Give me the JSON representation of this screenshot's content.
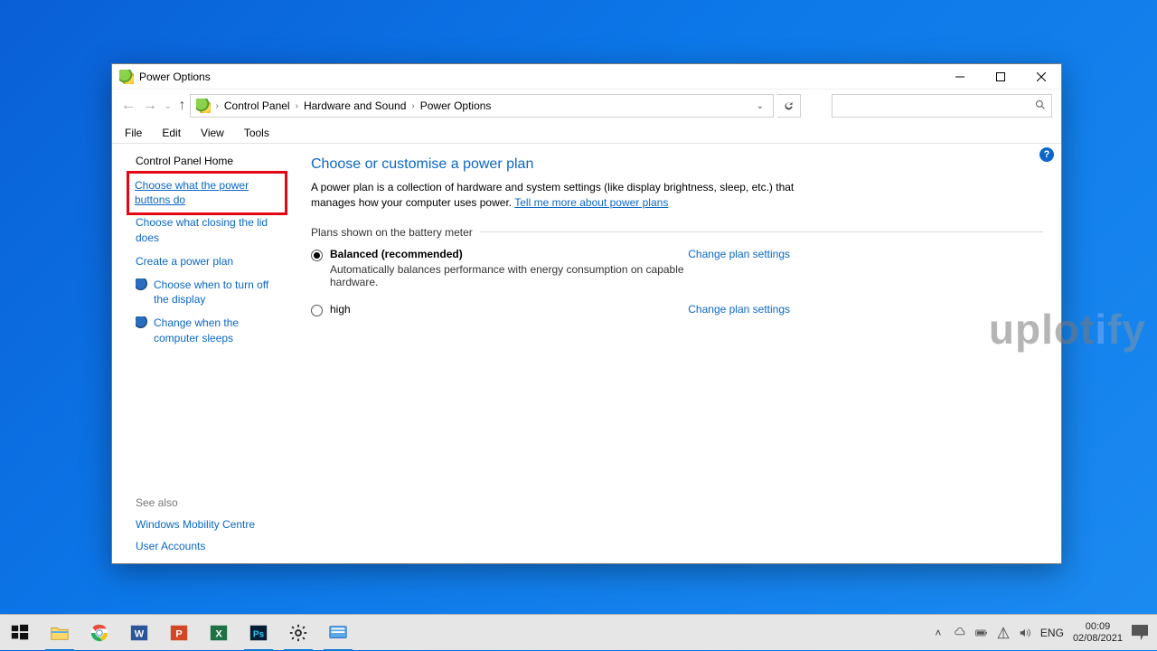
{
  "window": {
    "title": "Power Options",
    "breadcrumbs": [
      "Control Panel",
      "Hardware and Sound",
      "Power Options"
    ],
    "menu": {
      "file": "File",
      "edit": "Edit",
      "view": "View",
      "tools": "Tools"
    }
  },
  "sidebar": {
    "home": "Control Panel Home",
    "links": {
      "choose_power_buttons": "Choose what the power buttons do",
      "choose_lid": "Choose what closing the lid does",
      "create_plan": "Create a power plan",
      "turn_off_display": "Choose when to turn off the display",
      "computer_sleeps": "Change when the computer sleeps"
    },
    "see_also": "See also",
    "seealso_links": {
      "mobility": "Windows Mobility Centre",
      "user_accounts": "User Accounts"
    }
  },
  "main": {
    "heading": "Choose or customise a power plan",
    "intro_1": "A power plan is a collection of hardware and system settings (like display brightness, sleep, etc.) that manages how your computer uses power. ",
    "intro_link": "Tell me more about power plans",
    "section_label": "Plans shown on the battery meter",
    "plans": [
      {
        "name": "Balanced (recommended)",
        "desc": "Automatically balances performance with energy consumption on capable hardware.",
        "settings_link": "Change plan settings",
        "selected": true
      },
      {
        "name": "high",
        "desc": "",
        "settings_link": "Change plan settings",
        "selected": false
      }
    ]
  },
  "watermark": {
    "p1": "uplot",
    "p2": "i",
    "p3": "fy"
  },
  "systray": {
    "lang": "ENG",
    "time": "00:09",
    "date": "02/08/2021"
  }
}
